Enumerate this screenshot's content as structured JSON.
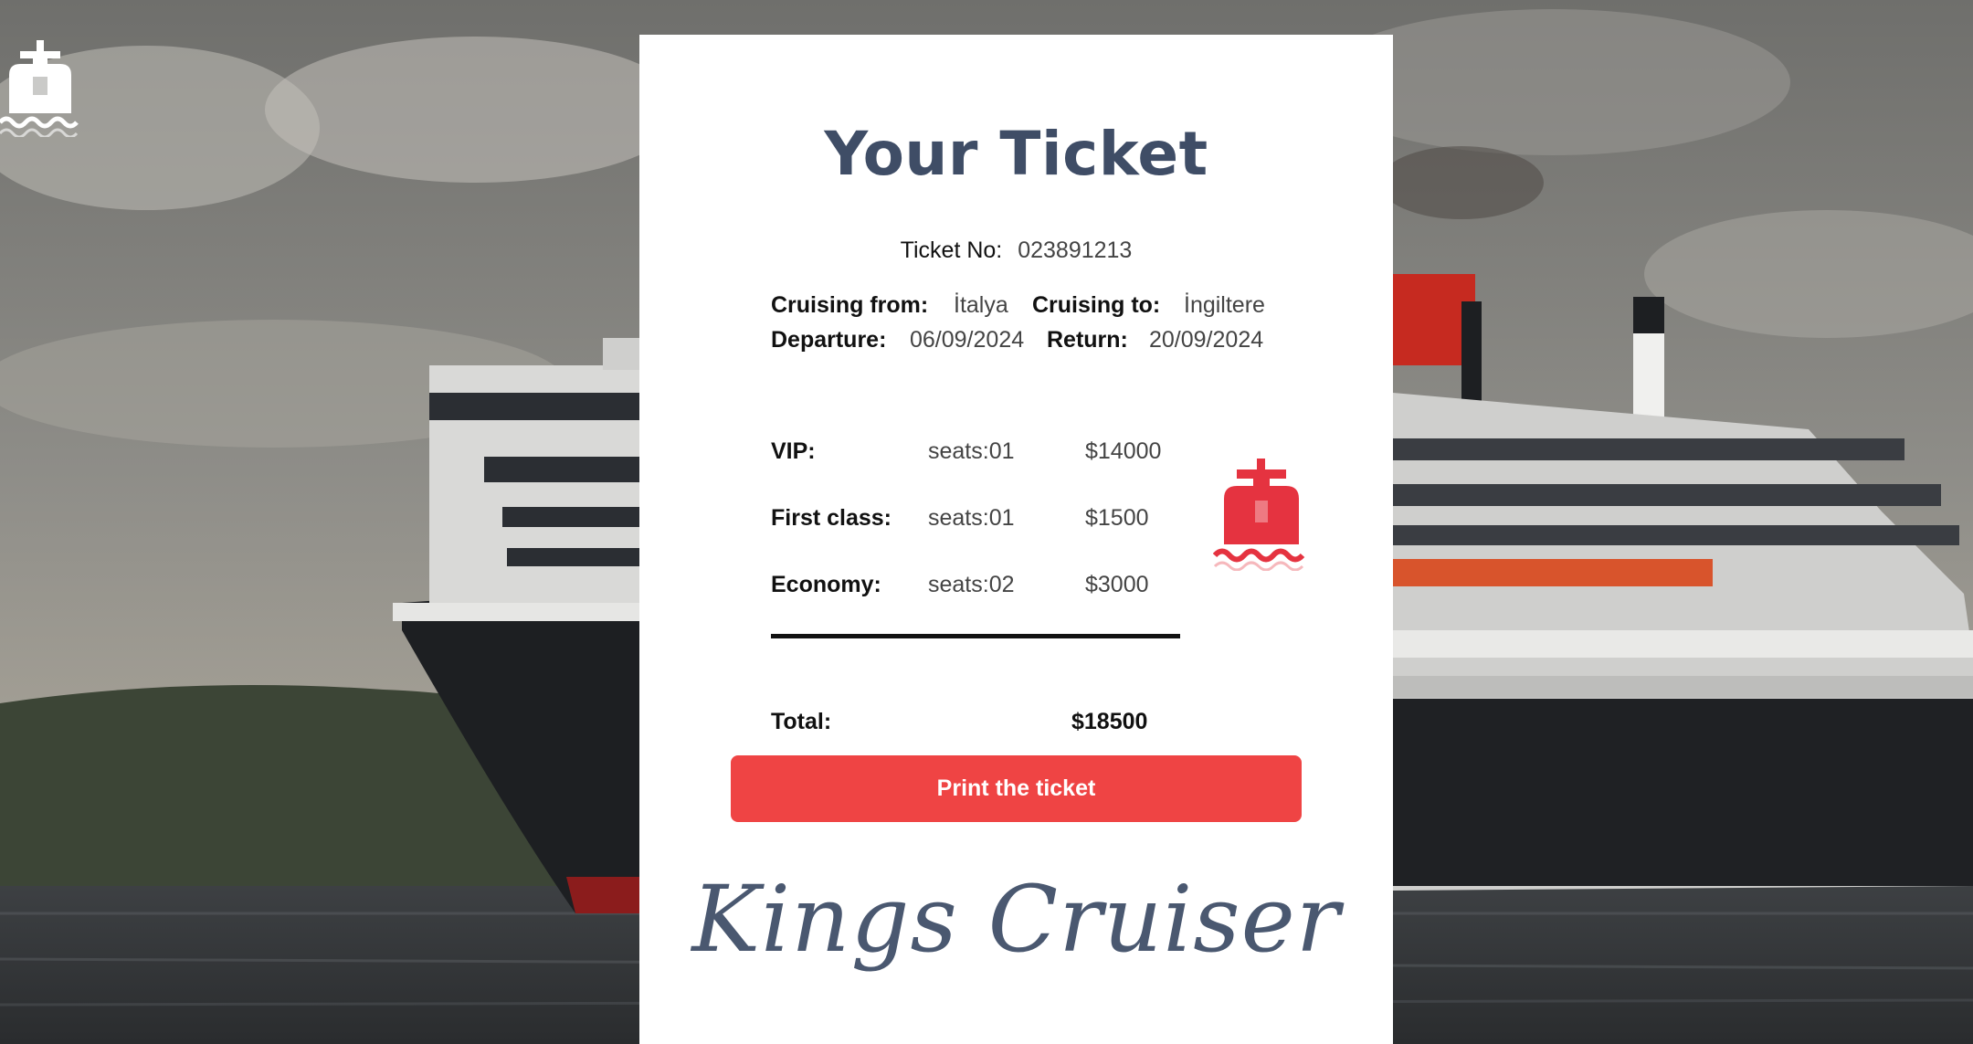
{
  "card": {
    "title": "Your Ticket",
    "ticket_no_label": "Ticket No:",
    "ticket_no_value": "023891213"
  },
  "route": {
    "from_label": "Cruising from:",
    "from_value": "İtalya",
    "to_label": "Cruising to:",
    "to_value": "İngiltere",
    "departure_label": "Departure:",
    "departure_value": "06/09/2024",
    "return_label": "Return:",
    "return_value": "20/09/2024"
  },
  "items": [
    {
      "label": "VIP:",
      "seats": "seats:01",
      "price": "$14000"
    },
    {
      "label": "First class:",
      "seats": "seats:01",
      "price": "$1500"
    },
    {
      "label": "Economy:",
      "seats": "seats:02",
      "price": "$3000"
    }
  ],
  "total": {
    "label": "Total:",
    "value": "$18500"
  },
  "print_button": "Print the ticket",
  "brand": "Kings Cruiser",
  "colors": {
    "accent": "#ef4444",
    "title": "#3f4d66",
    "logo_red": "#e53340"
  },
  "icons": [
    "ship-logo-icon"
  ]
}
